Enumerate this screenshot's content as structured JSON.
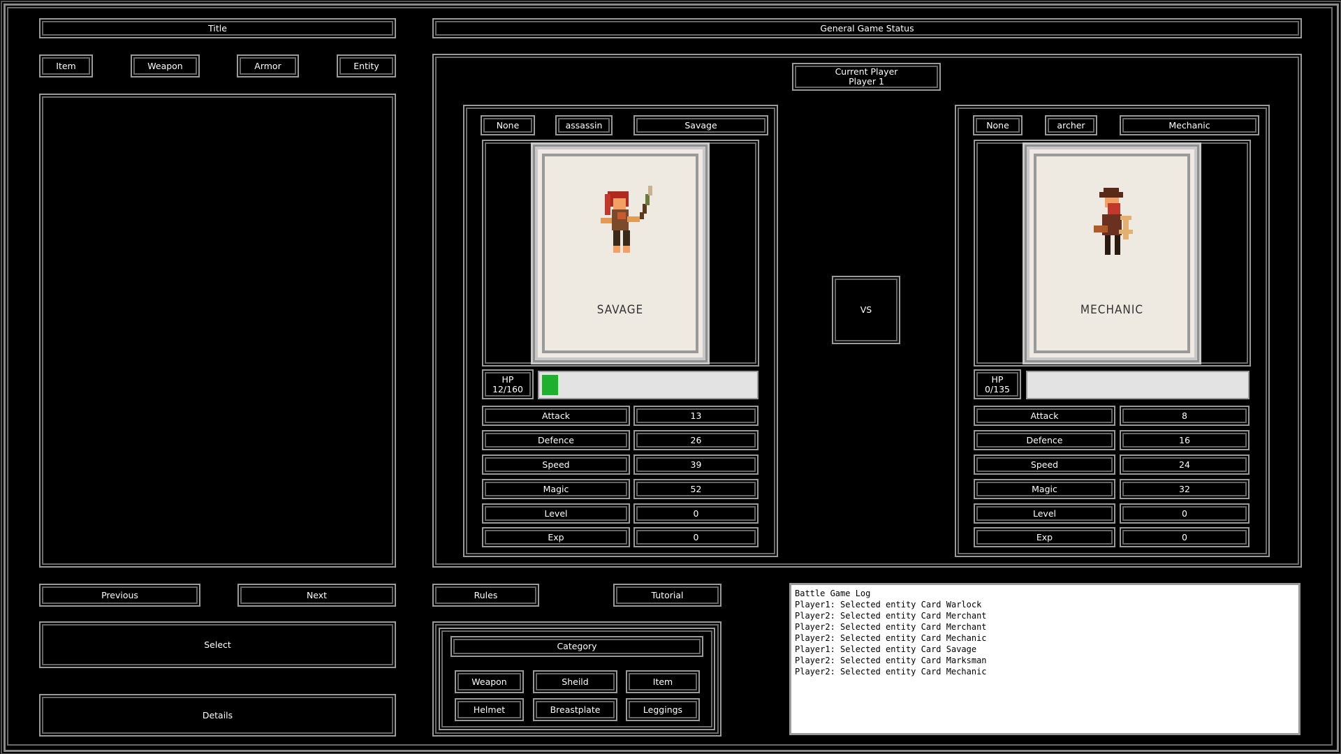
{
  "title": "Title",
  "status_title": "General Game Status",
  "categories_top": [
    "Item",
    "Weapon",
    "Armor",
    "Entity"
  ],
  "nav": {
    "previous": "Previous",
    "next": "Next",
    "select": "Select",
    "details": "Details"
  },
  "current_player": {
    "label": "Current Player",
    "value": "Player 1"
  },
  "vs": "VS",
  "rules": "Rules",
  "tutorial": "Tutorial",
  "category_panel": {
    "title": "Category",
    "items": [
      "Weapon",
      "Sheild",
      "Item",
      "Helmet",
      "Breastplate",
      "Leggings"
    ]
  },
  "player1": {
    "slot1": "None",
    "slot2": "assassin",
    "slot3": "Savage",
    "card_name": "SAVAGE",
    "hp_label": "HP",
    "hp_value": "12/160",
    "hp_fraction": 0.075,
    "stats": [
      {
        "label": "Attack",
        "value": "13"
      },
      {
        "label": "Defence",
        "value": "26"
      },
      {
        "label": "Speed",
        "value": "39"
      },
      {
        "label": "Magic",
        "value": "52"
      },
      {
        "label": "Level",
        "value": "0"
      },
      {
        "label": "Exp",
        "value": "0"
      }
    ]
  },
  "player2": {
    "slot1": "None",
    "slot2": "archer",
    "slot3": "Mechanic",
    "card_name": "MECHANIC",
    "hp_label": "HP",
    "hp_value": "0/135",
    "hp_fraction": 0,
    "stats": [
      {
        "label": "Attack",
        "value": "8"
      },
      {
        "label": "Defence",
        "value": "16"
      },
      {
        "label": "Speed",
        "value": "24"
      },
      {
        "label": "Magic",
        "value": "32"
      },
      {
        "label": "Level",
        "value": "0"
      },
      {
        "label": "Exp",
        "value": "0"
      }
    ]
  },
  "log": {
    "lines": [
      "Battle Game Log",
      "Player1: Selected entity Card Warlock",
      "Player2: Selected entity Card Merchant",
      "Player2: Selected entity Card Merchant",
      "Player2: Selected entity Card Mechanic",
      "Player1: Selected entity Card Savage",
      "Player2: Selected entity Card Marksman",
      "Player2: Selected entity Card Mechanic"
    ]
  },
  "colors": {
    "hp_fill": "#1fb030",
    "frame": "#9a9a9a",
    "log_bg": "#ffffff"
  }
}
